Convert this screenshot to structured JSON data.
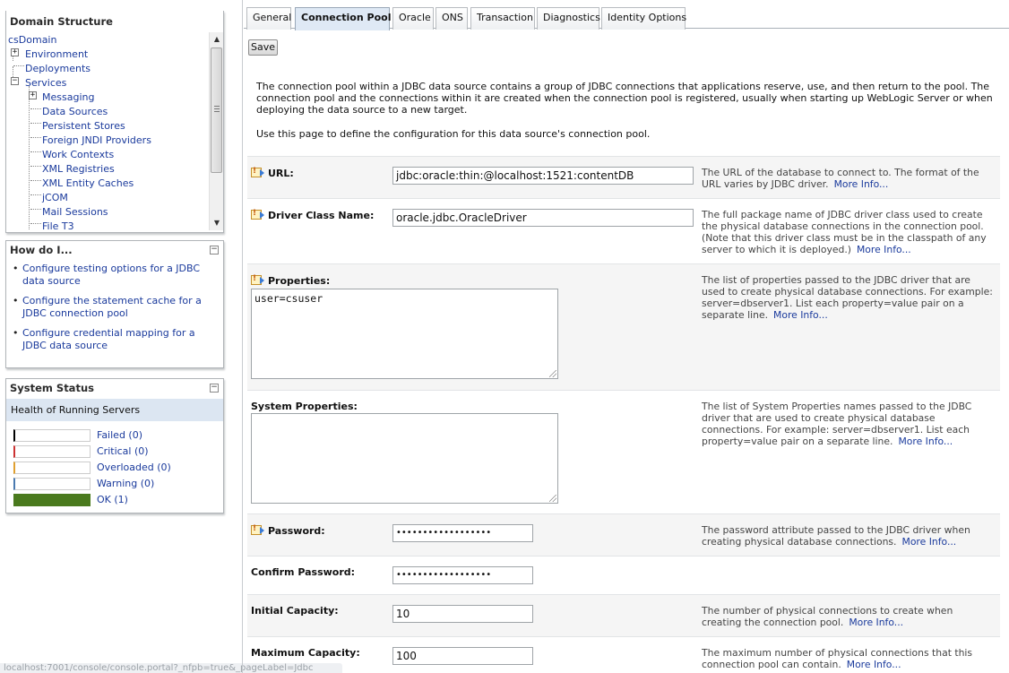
{
  "domain_structure": {
    "title": "Domain Structure",
    "tree": [
      {
        "label": "csDomain",
        "link": true
      },
      {
        "label": "Environment",
        "link": true,
        "expander": "+"
      },
      {
        "label": "Deployments",
        "link": true
      },
      {
        "label": "Services",
        "link": true,
        "expander": "−"
      },
      {
        "label": "Messaging",
        "link": true,
        "expander": "+"
      },
      {
        "label": "Data Sources",
        "link": true
      },
      {
        "label": "Persistent Stores",
        "link": true
      },
      {
        "label": "Foreign JNDI Providers",
        "link": true
      },
      {
        "label": "Work Contexts",
        "link": true
      },
      {
        "label": "XML Registries",
        "link": true
      },
      {
        "label": "XML Entity Caches",
        "link": true
      },
      {
        "label": "jCOM",
        "link": true
      },
      {
        "label": "Mail Sessions",
        "link": true
      },
      {
        "label": "File T3",
        "link": true
      }
    ]
  },
  "how_do_i": {
    "title": "How do I...",
    "items": [
      "Configure testing options for a JDBC data source",
      "Configure the statement cache for a JDBC connection pool",
      "Configure credential mapping for a JDBC data source"
    ]
  },
  "system_status": {
    "title": "System Status",
    "subtitle": "Health of Running Servers",
    "rows": [
      {
        "label": "Failed (0)",
        "color": "#000000",
        "fill": 0
      },
      {
        "label": "Critical (0)",
        "color": "#cc3333",
        "fill": 0
      },
      {
        "label": "Overloaded (0)",
        "color": "#e0a030",
        "fill": 0
      },
      {
        "label": "Warning (0)",
        "color": "#4a7ab0",
        "fill": 0
      },
      {
        "label": "OK (1)",
        "color": "#4a7a1e",
        "fill": 1
      }
    ]
  },
  "tabs": [
    "General",
    "Connection Pool",
    "Oracle",
    "ONS",
    "Transaction",
    "Diagnostics",
    "Identity Options"
  ],
  "active_tab": "Connection Pool",
  "save_label": "Save",
  "intro": {
    "p1": "The connection pool within a JDBC data source contains a group of JDBC connections that applications reserve, use, and then return to the pool. The connection pool and the connections within it are created when the connection pool is registered, usually when starting up WebLogic Server or when deploying the data source to a new target.",
    "p2": "Use this page to define the configuration for this data source's connection pool."
  },
  "more_info": "More Info...",
  "fields": {
    "url": {
      "label": "URL:",
      "value": "jdbc:oracle:thin:@localhost:1521:contentDB",
      "desc": "The URL of the database to connect to. The format of the URL varies by JDBC driver."
    },
    "driver": {
      "label": "Driver Class Name:",
      "value": "oracle.jdbc.OracleDriver",
      "desc": "The full package name of JDBC driver class used to create the physical database connections in the connection pool. (Note that this driver class must be in the classpath of any server to which it is deployed.)"
    },
    "properties": {
      "label": "Properties:",
      "value": "user=csuser",
      "desc": "The list of properties passed to the JDBC driver that are used to create physical database connections. For example: server=dbserver1. List each property=value pair on a separate line."
    },
    "system_properties": {
      "label": "System Properties:",
      "value": "",
      "desc": "The list of System Properties names passed to the JDBC driver that are used to create physical database connections. For example: server=dbserver1. List each property=value pair on a separate line."
    },
    "password": {
      "label": "Password:",
      "value": "••••••••••••••••••",
      "desc": "The password attribute passed to the JDBC driver when creating physical database connections."
    },
    "confirm_password": {
      "label": "Confirm Password:",
      "value": "••••••••••••••••••"
    },
    "initial_capacity": {
      "label": "Initial Capacity:",
      "value": "10",
      "desc": "The number of physical connections to create when creating the connection pool."
    },
    "maximum_capacity": {
      "label": "Maximum Capacity:",
      "value": "100",
      "desc": "The maximum number of physical connections that this connection pool can contain."
    }
  },
  "status_url": "localhost:7001/console/console.portal?_nfpb=true&_pageLabel=Jdbc"
}
